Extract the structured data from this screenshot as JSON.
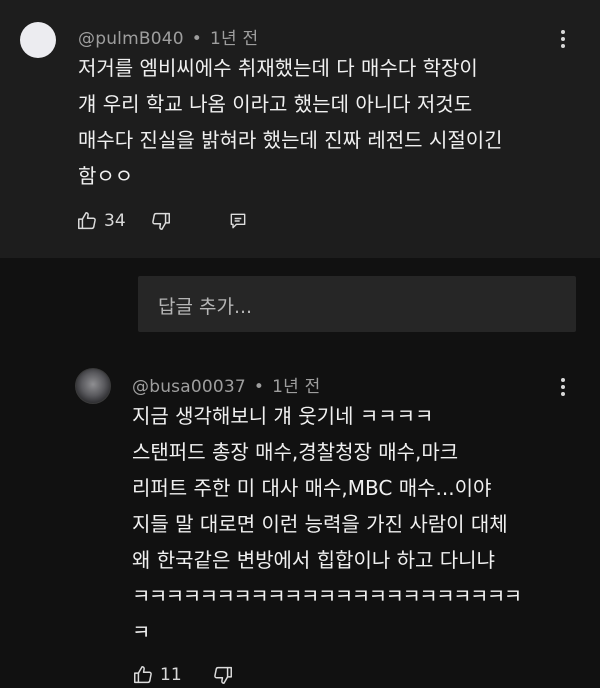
{
  "comment": {
    "author": "@pulmB040",
    "time": "1년 전",
    "lines": [
      "저거를 엠비씨에수 취재했는데 다 매수다 학장이",
      "걔 우리 학교 나옴 이라고 했는데 아니다 저것도",
      "매수다 진실을 밝혀라 했는데 진짜 레전드 시절이긴",
      "함ㅇㅇ"
    ],
    "likes": "34"
  },
  "reply_input": {
    "placeholder": "답글 추가..."
  },
  "reply": {
    "author": "@busa00037",
    "time": "1년 전",
    "lines": [
      "지금 생각해보니 걔 웃기네 ㅋㅋㅋㅋ",
      "스탠퍼드 총장 매수,경찰청장 매수,마크",
      "리퍼트 주한 미 대사 매수,MBC 매수...이야",
      "지들 말 대로면 이런 능력을 가진 사람이 대체",
      "왜 한국같은 변방에서 힙합이나 하고 다니냐",
      "ㅋㅋㅋㅋㅋㅋㅋㅋㅋㅋㅋㅋㅋㅋㅋㅋㅋㅋㅋㅋㅋㅋㅋ",
      "ㅋ"
    ],
    "likes": "11"
  },
  "separator": "•",
  "icons": {
    "like": "thumbs-up-icon",
    "dislike": "thumbs-down-icon",
    "reply": "reply-icon",
    "menu": "more-vert-icon"
  }
}
